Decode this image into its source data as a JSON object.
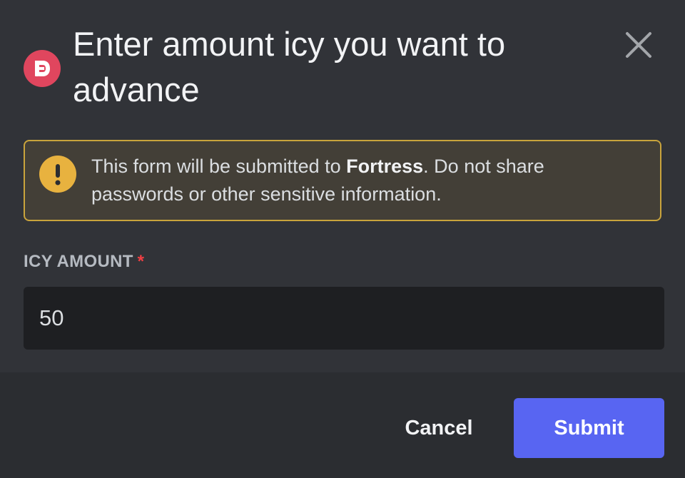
{
  "modal": {
    "title": "Enter amount icy you want to advance",
    "app_icon": "fortress-logo",
    "close_icon": "close-icon",
    "logo_color": "#e0465e"
  },
  "notice": {
    "icon": "warning-icon",
    "text_before": "This form will be submitted to ",
    "app_name": "Fortress",
    "text_after": ". Do not share passwords or other sensitive information.",
    "border_color": "#c9a43c",
    "icon_color": "#e8b23f"
  },
  "field": {
    "label": "ICY AMOUNT",
    "required_marker": "*",
    "value": "50"
  },
  "footer": {
    "cancel_label": "Cancel",
    "submit_label": "Submit",
    "submit_color": "#5865f2"
  }
}
